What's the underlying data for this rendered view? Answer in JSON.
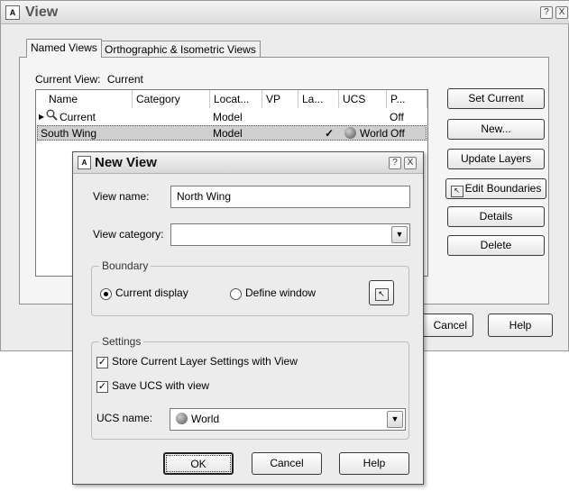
{
  "view_dialog": {
    "title": "View",
    "tabs": [
      "Named Views",
      "Orthographic & Isometric Views"
    ],
    "current_view_label": "Current View:",
    "current_view_value": "Current",
    "columns": [
      "Name",
      "Category",
      "Locat...",
      "VP",
      "La...",
      "UCS",
      "P..."
    ],
    "rows": [
      {
        "name": "Current",
        "category": "",
        "location": "Model",
        "vp": "",
        "layers": "",
        "ucs": "",
        "p": "Off"
      },
      {
        "name": "South Wing",
        "category": "",
        "location": "Model",
        "vp": "",
        "layers": "✓",
        "ucs": "World",
        "p": "Off"
      }
    ],
    "buttons": {
      "set_current": "Set Current",
      "new": "New...",
      "update_layers": "Update Layers",
      "edit_boundaries": "Edit Boundaries",
      "details": "Details",
      "delete": "Delete",
      "cancel": "Cancel",
      "help": "Help"
    }
  },
  "new_view_dialog": {
    "title": "New View",
    "view_name_label": "View name:",
    "view_name_value": "North Wing",
    "view_category_label": "View category:",
    "view_category_value": "",
    "boundary_legend": "Boundary",
    "current_display": "Current display",
    "define_window": "Define window",
    "settings_legend": "Settings",
    "store_layers": "Store Current Layer Settings with View",
    "save_ucs": "Save UCS with view",
    "ucs_name_label": "UCS name:",
    "ucs_name_value": "World",
    "ok": "OK",
    "cancel": "Cancel",
    "help": "Help"
  },
  "window_controls": {
    "help": "?",
    "close": "X"
  }
}
